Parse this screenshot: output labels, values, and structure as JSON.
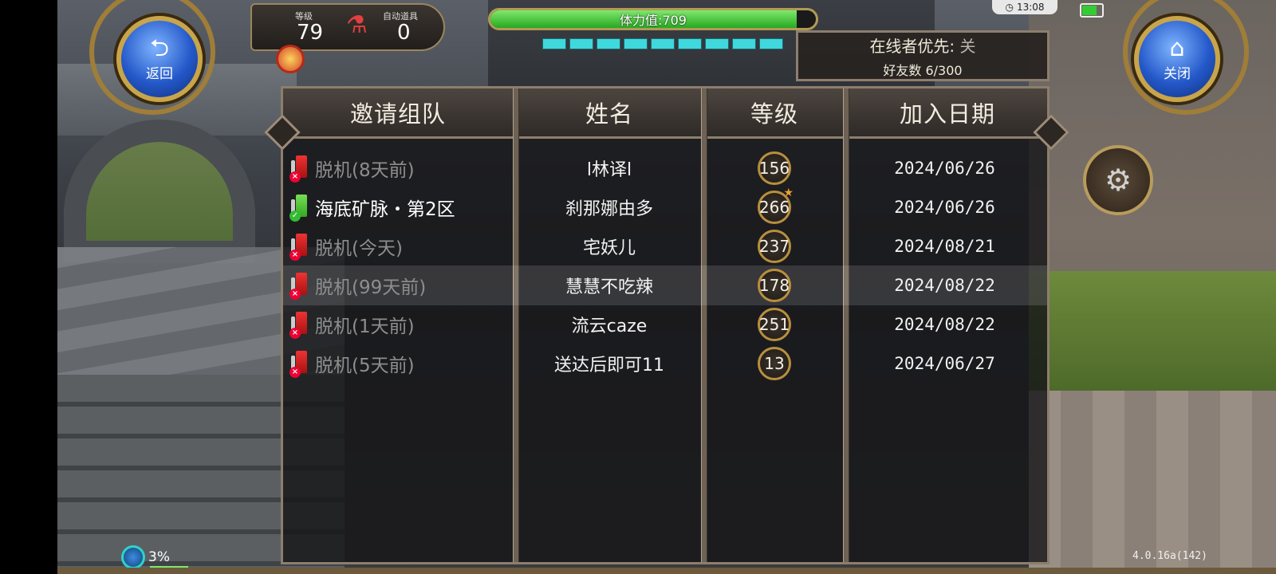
{
  "hud": {
    "back_label": "返回",
    "close_label": "关闭",
    "level_label": "等级",
    "level_value": "79",
    "auto_item_label": "自动道具",
    "auto_item_value": "0",
    "stamina_text": "体力值:709",
    "stamina_fraction": 0.94,
    "clock": "13:08",
    "network_percent": "3%",
    "version": "4.0.16a(142)"
  },
  "online_panel": {
    "priority_label": "在线者优先:",
    "priority_value": "关",
    "friend_count": "好友数 6/300"
  },
  "table": {
    "headers": [
      "邀请组队",
      "姓名",
      "等级",
      "加入日期"
    ],
    "rows": [
      {
        "status": "脱机(8天前)",
        "online": false,
        "name": "l林译l",
        "level": "156",
        "star": false,
        "date": "2024/06/26",
        "selected": false
      },
      {
        "status": "海底矿脉・第2区",
        "online": true,
        "name": "刹那娜由多",
        "level": "266",
        "star": true,
        "date": "2024/06/26",
        "selected": false
      },
      {
        "status": "脱机(今天)",
        "online": false,
        "name": "宅妖儿",
        "level": "237",
        "star": false,
        "date": "2024/08/21",
        "selected": false
      },
      {
        "status": "脱机(99天前)",
        "online": false,
        "name": "慧慧不吃辣",
        "level": "178",
        "star": false,
        "date": "2024/08/22",
        "selected": true
      },
      {
        "status": "脱机(1天前)",
        "online": false,
        "name": "流云caze",
        "level": "251",
        "star": false,
        "date": "2024/08/22",
        "selected": false
      },
      {
        "status": "脱机(5天前)",
        "online": false,
        "name": "送达后即可11",
        "level": "13",
        "star": false,
        "date": "2024/06/27",
        "selected": false
      }
    ]
  },
  "colors": {
    "online_status": "#ffffff",
    "offline_status": "#8d8d8d",
    "stamina_fill": "#27a822",
    "gold_border": "#c9a54a"
  }
}
